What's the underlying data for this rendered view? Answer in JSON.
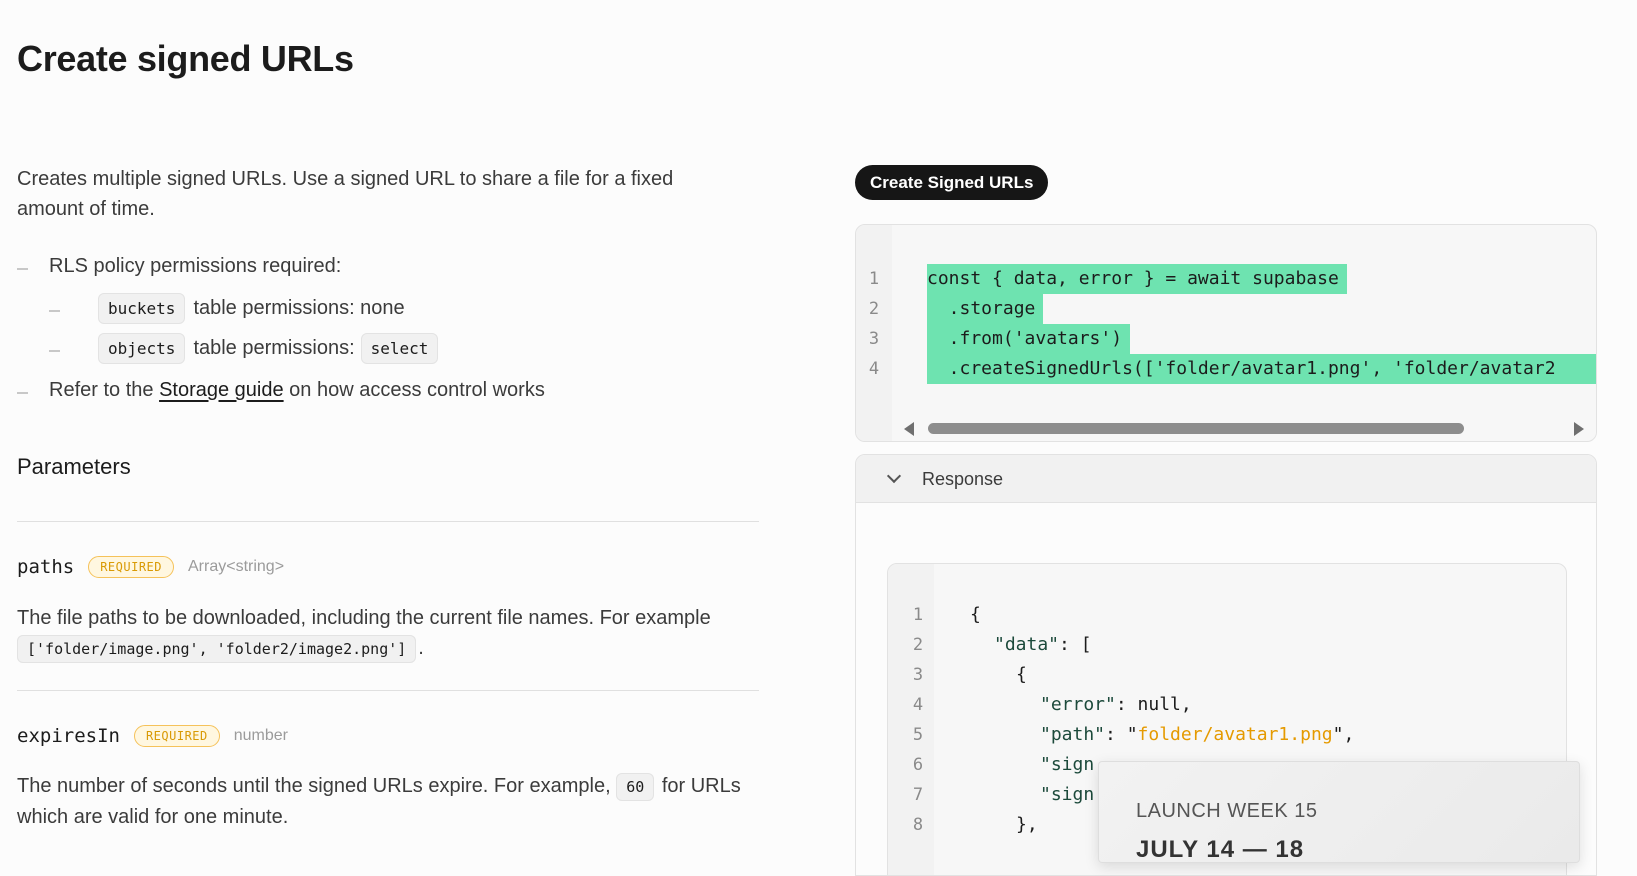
{
  "page": {
    "title": "Create signed URLs",
    "intro": "Creates multiple signed URLs. Use a signed URL to share a file for a fixed amount of time."
  },
  "bullets": {
    "rls": "RLS policy permissions required:",
    "buckets_code": "buckets",
    "buckets_text": "table permissions: none",
    "objects_code": "objects",
    "objects_text": "table permissions:",
    "objects_select": "select",
    "refer_pre": "Refer to the ",
    "refer_link": "Storage guide",
    "refer_post": " on how access control works"
  },
  "parameters": {
    "heading": "Parameters",
    "items": [
      {
        "name": "paths",
        "badge": "REQUIRED",
        "type": "Array<string>",
        "desc": "The file paths to be downloaded, including the current file names. For example",
        "example": "['folder/image.png', 'folder2/image2.png']",
        "example_suffix": "."
      },
      {
        "name": "expiresIn",
        "badge": "REQUIRED",
        "type": "number",
        "desc_pre": "The number of seconds until the signed URLs expire. For example,",
        "example": "60",
        "desc_post": "for URLs which are valid for one minute."
      }
    ]
  },
  "example": {
    "button_label": "Create Signed URLs",
    "line_numbers": [
      "1",
      "2",
      "3",
      "4"
    ],
    "lines": [
      "const { data, error } = await supabase",
      "  .storage",
      "  .from('avatars')",
      "  .createSignedUrls(['folder/avatar1.png', 'folder/avatar2"
    ]
  },
  "response": {
    "label": "Response",
    "line_numbers": [
      "1",
      "2",
      "3",
      "4",
      "5",
      "6",
      "7",
      "8"
    ],
    "lines": {
      "l1": "{",
      "l2_key": "\"data\"",
      "l2_rest": ": [",
      "l3": "{",
      "l4_key": "\"error\"",
      "l4_rest": ": null,",
      "l5_key": "\"path\"",
      "l5_mid": ": \"",
      "l5_val": "folder/avatar1.png",
      "l5_end": "\",",
      "l6_key": "\"sign",
      "l7_key": "\"sign",
      "l8": "},"
    }
  },
  "overlay": {
    "title": "LAUNCH WEEK 15",
    "subtitle": "JULY 14 — 18"
  },
  "colors": {
    "highlight": "#6ee3b0",
    "badge": "#d99a05",
    "string": "#e59a00"
  }
}
